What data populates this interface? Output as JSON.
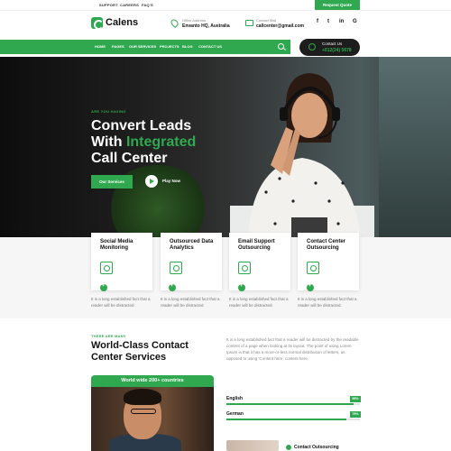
{
  "topbar": {
    "links": [
      "SUPPORT",
      "CAREERS",
      "FAQ'S"
    ],
    "quote_button": "Request Quote"
  },
  "header": {
    "brand": "Calens",
    "office": {
      "label": "Office Address",
      "value": "Envanto HQ, Australia"
    },
    "mail": {
      "label": "Contact Mail",
      "value": "callcenter@gmail.com"
    },
    "social": [
      "f",
      "t",
      "in",
      "G"
    ]
  },
  "nav": {
    "items": [
      "HOME",
      "PAGES",
      "OUR SERVICES",
      "PROJECTS",
      "BLOG",
      "CONTACT US"
    ]
  },
  "contact_pill": {
    "label": "Contact Us",
    "phone": "+012(34) 5678"
  },
  "hero": {
    "eyebrow": "ARE YOU HAVING",
    "line1": "Convert Leads",
    "line2_a": "With ",
    "line2_b": "Integrated",
    "line3": "Call Center",
    "services_button": "Our Services",
    "play_label": "Play Now"
  },
  "cards": [
    {
      "title": "Social Media Monitoring",
      "icon": "monitor-icon",
      "desc": "It is a long established fact that a reader will be distracted"
    },
    {
      "title": "Outsourced Data Analytics",
      "icon": "analytics-icon",
      "desc": "It is a long established fact that a reader will be distracted"
    },
    {
      "title": "Email Support Outsourcing",
      "icon": "email-support-icon",
      "desc": "It is a long established fact that a reader will be distracted."
    },
    {
      "title": "Contact Center Outsourcing",
      "icon": "contact-center-icon",
      "desc": "It is a long established fact that a reader will be distracted."
    }
  ],
  "world_class": {
    "eyebrow": "THERE ARE MANY",
    "title1": "World-Class Contact",
    "title2": "Center Services",
    "para": "It is a long established fact that a reader will be distracted by the readable content of a page when looking at its layout. The point of using Lorem Ipsum is that it has a more-or-less normal distribution of letters, as opposed to using 'Content here, content here.",
    "world_bar": "World wide 200+ countries",
    "languages": [
      {
        "name": "English",
        "percent": 95,
        "label": "95%"
      },
      {
        "name": "German",
        "percent": 90,
        "label": "75%"
      }
    ],
    "contact_outsourcing": "Contact Outsourcing"
  },
  "colors": {
    "accent": "#2fa84f",
    "dark": "#1d1d1d"
  }
}
